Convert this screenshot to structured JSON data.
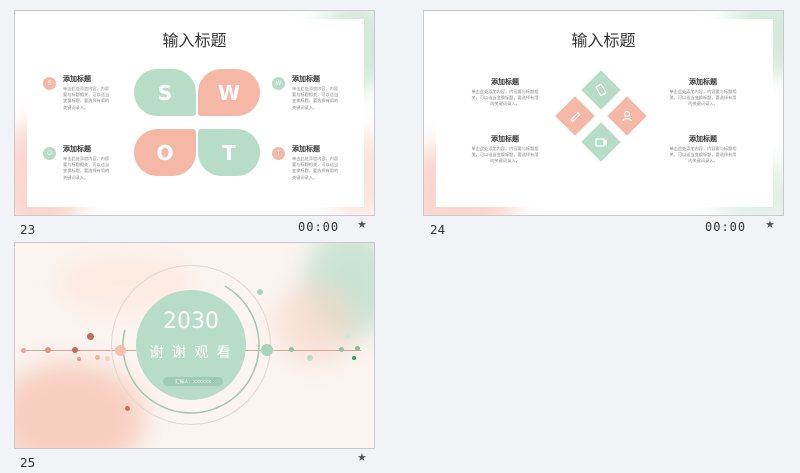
{
  "slides": [
    {
      "number": "23",
      "time": "00:00",
      "title": "输入标题",
      "swot": [
        "S",
        "W",
        "O",
        "T"
      ],
      "items": [
        {
          "badge": "S",
          "heading": "添加标题",
          "text": [
            "单击此处添加内容，内容",
            "要与标题相关，可以适当",
            "变换标题，要选择有用的",
            "关键词录入。"
          ]
        },
        {
          "badge": "O",
          "heading": "添加标题",
          "text": [
            "单击此处添加内容，内容",
            "要与标题相关，可以适当",
            "变换标题，要选择有用的",
            "关键词录入。"
          ]
        },
        {
          "badge": "W",
          "heading": "添加标题",
          "text": [
            "单击此处添加内容，内容",
            "要与标题相关，可以适当",
            "变换标题，要选择有用的",
            "关键词录入。"
          ]
        },
        {
          "badge": "T",
          "heading": "添加标题",
          "text": [
            "单击此处添加内容，内容",
            "要与标题相关，可以适当",
            "变换标题，要选择有用的",
            "关键词录入。"
          ]
        }
      ],
      "colors": {
        "pink": "#f5b8a6",
        "green": "#b7dcc8"
      }
    },
    {
      "number": "24",
      "time": "00:00",
      "title": "输入标题",
      "items": [
        {
          "heading": "添加标题",
          "text": [
            "单击此处添加内容，内容要与标题相",
            "关，可以适当变换标题，要选择有用",
            "的关键词录入。"
          ]
        },
        {
          "heading": "添加标题",
          "text": [
            "单击此处添加内容，内容要与标题相",
            "关，可以适当变换标题，要选择有用",
            "的关键词录入。"
          ]
        },
        {
          "heading": "添加标题",
          "text": [
            "单击此处添加内容，内容要与标题相",
            "关，可以适当变换标题，要选择有用",
            "的关键词录入。"
          ]
        },
        {
          "heading": "添加标题",
          "text": [
            "单击此处添加内容，内容要与标题相",
            "关，可以适当变换标题，要选择有用",
            "的关键词录入。"
          ]
        }
      ],
      "icons": [
        "phone-icon",
        "pen-icon",
        "person-icon",
        "camera-icon"
      ]
    },
    {
      "number": "25",
      "year": "2030",
      "thanks": "谢 谢 观 看",
      "reporter": "汇报人：XXXXXX"
    }
  ],
  "star_glyph": "★"
}
